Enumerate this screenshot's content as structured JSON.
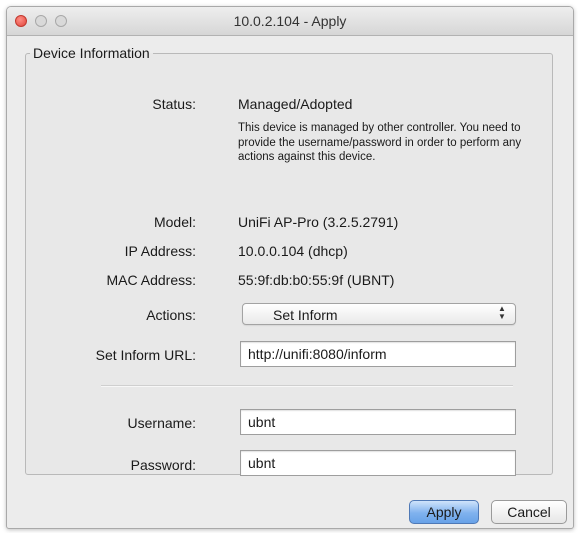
{
  "window": {
    "title": "10.0.2.104 - Apply"
  },
  "device_info": {
    "legend": "Device Information",
    "status_label": "Status:",
    "status_value": "Managed/Adopted",
    "status_note": "This device is managed by other controller. You need to provide the username/password in order to perform any actions against this device.",
    "model_label": "Model:",
    "model_value": "UniFi AP-Pro (3.2.5.2791)",
    "ip_label": "IP Address:",
    "ip_value": "10.0.0.104 (dhcp)",
    "mac_label": "MAC Address:",
    "mac_value": "55:9f:db:b0:55:9f (UBNT)",
    "actions_label": "Actions:",
    "actions_selected": "Set Inform",
    "inform_url_label": "Set Inform URL:",
    "inform_url_value": "http://unifi:8080/inform",
    "username_label": "Username:",
    "username_value": "ubnt",
    "password_label": "Password:",
    "password_value": "ubnt"
  },
  "buttons": {
    "apply": "Apply",
    "cancel": "Cancel"
  },
  "icons": {
    "close": "close-icon",
    "minimize": "minimize-icon",
    "maximize": "maximize-icon",
    "select_arrows": "updown-arrows-icon"
  }
}
